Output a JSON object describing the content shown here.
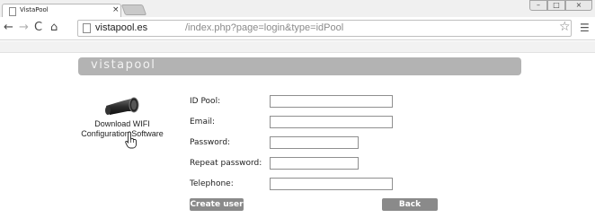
{
  "browser": {
    "tab_title": "VistaPool",
    "tab_close": "×",
    "window_controls": {
      "minimize": "–",
      "maximize": "□",
      "close": "×"
    },
    "nav": {
      "back": "←",
      "forward": "→",
      "reload": "C",
      "home": "⌂"
    },
    "url_host": "vistapool.es",
    "url_path": "/index.php?page=login&type=idPool",
    "star": "☆",
    "menu": "☰"
  },
  "page": {
    "logo": "vistapool",
    "download": {
      "line1": "Download WIFI",
      "line2": "Configuration Software"
    },
    "form": {
      "id_pool_label": "ID Pool:",
      "email_label": "Email:",
      "password_label": "Password:",
      "repeat_password_label": "Repeat password:",
      "telephone_label": "Telephone:",
      "id_pool_value": "",
      "email_value": "",
      "password_value": "",
      "repeat_password_value": "",
      "telephone_value": ""
    },
    "buttons": {
      "create_user": "Create user",
      "back": "Back"
    }
  },
  "colors": {
    "banner": "#b3b3b3",
    "button": "#8a8a8a",
    "chrome": "#f0f0f0"
  }
}
